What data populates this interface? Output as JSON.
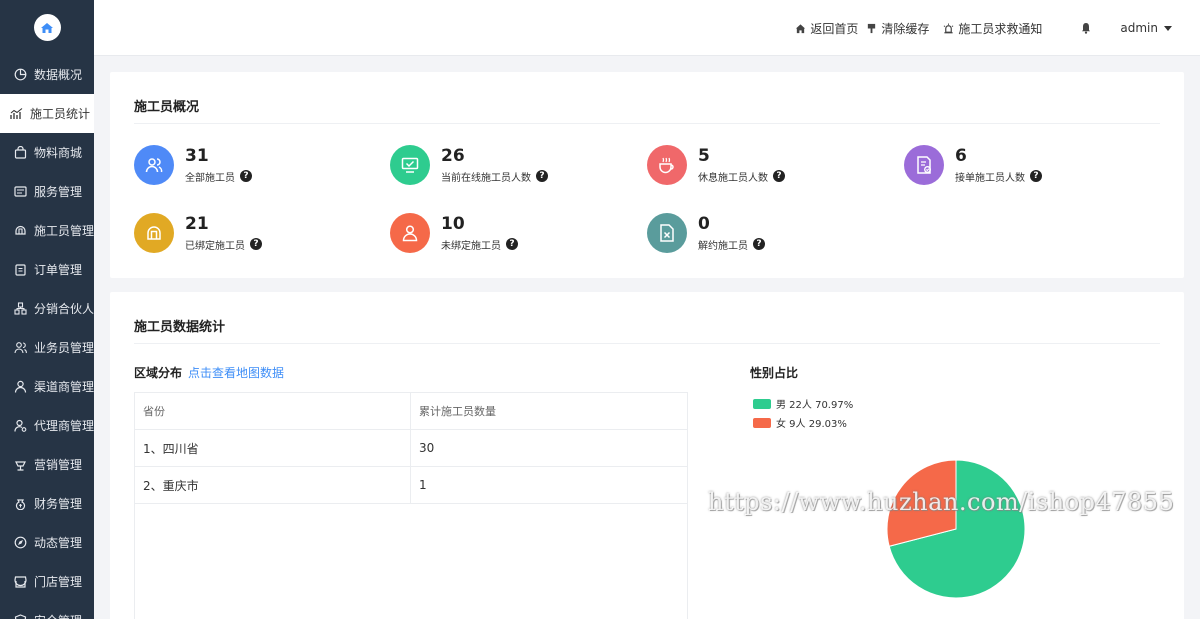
{
  "sidebar": {
    "items": [
      {
        "label": "数据概况",
        "icon": "pie-chart-icon"
      },
      {
        "label": "施工员统计",
        "icon": "line-chart-icon",
        "active": true
      },
      {
        "label": "物料商城",
        "icon": "shopping-bag-icon"
      },
      {
        "label": "服务管理",
        "icon": "service-icon"
      },
      {
        "label": "施工员管理",
        "icon": "helmet-icon"
      },
      {
        "label": "订单管理",
        "icon": "clipboard-icon"
      },
      {
        "label": "分销合伙人",
        "icon": "network-icon"
      },
      {
        "label": "业务员管理",
        "icon": "users-icon"
      },
      {
        "label": "渠道商管理",
        "icon": "user-icon"
      },
      {
        "label": "代理商管理",
        "icon": "user-gear-icon"
      },
      {
        "label": "营销管理",
        "icon": "marketing-icon"
      },
      {
        "label": "财务管理",
        "icon": "money-bag-icon"
      },
      {
        "label": "动态管理",
        "icon": "compass-icon"
      },
      {
        "label": "门店管理",
        "icon": "store-icon"
      },
      {
        "label": "安全管理",
        "icon": "shield-icon"
      }
    ]
  },
  "header": {
    "home": "返回首页",
    "clear_cache": "清除缓存",
    "sos_notice": "施工员求救通知",
    "user": "admin"
  },
  "overview": {
    "title": "施工员概况",
    "stats": [
      {
        "value": "31",
        "label": "全部施工员",
        "color": "#4f8af7",
        "icon": "users-icon"
      },
      {
        "value": "26",
        "label": "当前在线施工员人数",
        "color": "#2ecc8f",
        "icon": "monitor-icon"
      },
      {
        "value": "5",
        "label": "休息施工员人数",
        "color": "#f0686a",
        "icon": "coffee-icon"
      },
      {
        "value": "6",
        "label": "接单施工员人数",
        "color": "#9b6cd9",
        "icon": "document-check-icon"
      },
      {
        "value": "21",
        "label": "已绑定施工员",
        "color": "#e1a924",
        "icon": "helmet-icon"
      },
      {
        "value": "10",
        "label": "未绑定施工员",
        "color": "#f56949",
        "icon": "person-icon"
      },
      {
        "value": "0",
        "label": "解约施工员",
        "color": "#5a9c9c",
        "icon": "file-cancel-icon"
      }
    ]
  },
  "statistics": {
    "title": "施工员数据统计",
    "region_title": "区域分布",
    "map_link": "点击查看地图数据",
    "table": {
      "headers": [
        "省份",
        "累计施工员数量"
      ],
      "rows": [
        [
          "1、四川省",
          "30"
        ],
        [
          "2、重庆市",
          "1"
        ]
      ]
    },
    "gender_title": "性别占比"
  },
  "chart_data": {
    "type": "pie",
    "title": "性别占比",
    "series": [
      {
        "name": "男",
        "value": 22,
        "label": "男 22人 70.97%",
        "color": "#2ecc8f"
      },
      {
        "name": "女",
        "value": 9,
        "label": "女 9人 29.03%",
        "color": "#f56949"
      }
    ]
  },
  "watermark": "https://www.huzhan.com/ishop47855"
}
